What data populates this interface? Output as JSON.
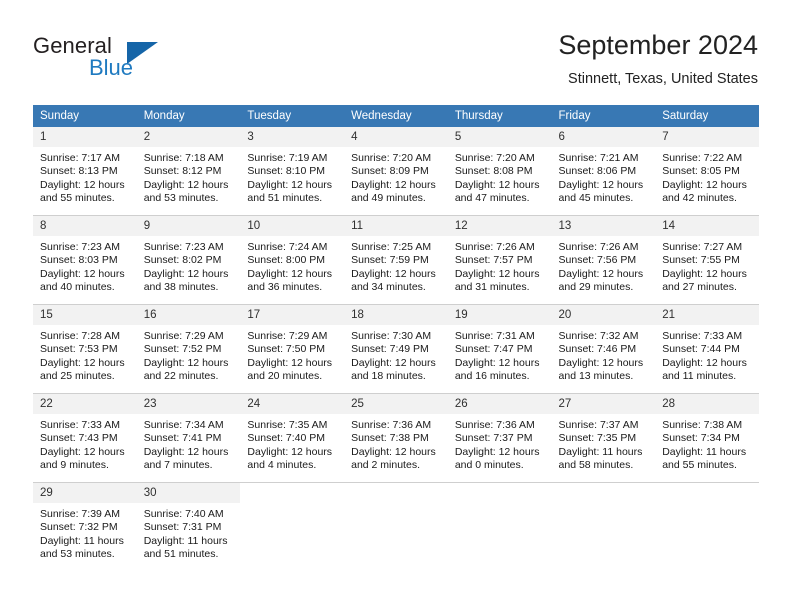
{
  "logo": {
    "word_one": "General",
    "word_two": "Blue",
    "triangle_color": "#1565a8",
    "blue_color": "#1f7ac0"
  },
  "header": {
    "title": "September 2024",
    "subtitle": "Stinnett, Texas, United States"
  },
  "theme": {
    "header_row_bg": "#3878b4",
    "daynum_bg": "#f2f2f2",
    "grid_line": "#cfcfcf"
  },
  "weekday_headers": [
    "Sunday",
    "Monday",
    "Tuesday",
    "Wednesday",
    "Thursday",
    "Friday",
    "Saturday"
  ],
  "labels": {
    "sunrise_prefix": "Sunrise:",
    "sunset_prefix": "Sunset:",
    "daylight_prefix": "Daylight:"
  },
  "weeks": [
    [
      {
        "day": "1",
        "sunrise": "Sunrise: 7:17 AM",
        "sunset": "Sunset: 8:13 PM",
        "daylight": "Daylight: 12 hours and 55 minutes."
      },
      {
        "day": "2",
        "sunrise": "Sunrise: 7:18 AM",
        "sunset": "Sunset: 8:12 PM",
        "daylight": "Daylight: 12 hours and 53 minutes."
      },
      {
        "day": "3",
        "sunrise": "Sunrise: 7:19 AM",
        "sunset": "Sunset: 8:10 PM",
        "daylight": "Daylight: 12 hours and 51 minutes."
      },
      {
        "day": "4",
        "sunrise": "Sunrise: 7:20 AM",
        "sunset": "Sunset: 8:09 PM",
        "daylight": "Daylight: 12 hours and 49 minutes."
      },
      {
        "day": "5",
        "sunrise": "Sunrise: 7:20 AM",
        "sunset": "Sunset: 8:08 PM",
        "daylight": "Daylight: 12 hours and 47 minutes."
      },
      {
        "day": "6",
        "sunrise": "Sunrise: 7:21 AM",
        "sunset": "Sunset: 8:06 PM",
        "daylight": "Daylight: 12 hours and 45 minutes."
      },
      {
        "day": "7",
        "sunrise": "Sunrise: 7:22 AM",
        "sunset": "Sunset: 8:05 PM",
        "daylight": "Daylight: 12 hours and 42 minutes."
      }
    ],
    [
      {
        "day": "8",
        "sunrise": "Sunrise: 7:23 AM",
        "sunset": "Sunset: 8:03 PM",
        "daylight": "Daylight: 12 hours and 40 minutes."
      },
      {
        "day": "9",
        "sunrise": "Sunrise: 7:23 AM",
        "sunset": "Sunset: 8:02 PM",
        "daylight": "Daylight: 12 hours and 38 minutes."
      },
      {
        "day": "10",
        "sunrise": "Sunrise: 7:24 AM",
        "sunset": "Sunset: 8:00 PM",
        "daylight": "Daylight: 12 hours and 36 minutes."
      },
      {
        "day": "11",
        "sunrise": "Sunrise: 7:25 AM",
        "sunset": "Sunset: 7:59 PM",
        "daylight": "Daylight: 12 hours and 34 minutes."
      },
      {
        "day": "12",
        "sunrise": "Sunrise: 7:26 AM",
        "sunset": "Sunset: 7:57 PM",
        "daylight": "Daylight: 12 hours and 31 minutes."
      },
      {
        "day": "13",
        "sunrise": "Sunrise: 7:26 AM",
        "sunset": "Sunset: 7:56 PM",
        "daylight": "Daylight: 12 hours and 29 minutes."
      },
      {
        "day": "14",
        "sunrise": "Sunrise: 7:27 AM",
        "sunset": "Sunset: 7:55 PM",
        "daylight": "Daylight: 12 hours and 27 minutes."
      }
    ],
    [
      {
        "day": "15",
        "sunrise": "Sunrise: 7:28 AM",
        "sunset": "Sunset: 7:53 PM",
        "daylight": "Daylight: 12 hours and 25 minutes."
      },
      {
        "day": "16",
        "sunrise": "Sunrise: 7:29 AM",
        "sunset": "Sunset: 7:52 PM",
        "daylight": "Daylight: 12 hours and 22 minutes."
      },
      {
        "day": "17",
        "sunrise": "Sunrise: 7:29 AM",
        "sunset": "Sunset: 7:50 PM",
        "daylight": "Daylight: 12 hours and 20 minutes."
      },
      {
        "day": "18",
        "sunrise": "Sunrise: 7:30 AM",
        "sunset": "Sunset: 7:49 PM",
        "daylight": "Daylight: 12 hours and 18 minutes."
      },
      {
        "day": "19",
        "sunrise": "Sunrise: 7:31 AM",
        "sunset": "Sunset: 7:47 PM",
        "daylight": "Daylight: 12 hours and 16 minutes."
      },
      {
        "day": "20",
        "sunrise": "Sunrise: 7:32 AM",
        "sunset": "Sunset: 7:46 PM",
        "daylight": "Daylight: 12 hours and 13 minutes."
      },
      {
        "day": "21",
        "sunrise": "Sunrise: 7:33 AM",
        "sunset": "Sunset: 7:44 PM",
        "daylight": "Daylight: 12 hours and 11 minutes."
      }
    ],
    [
      {
        "day": "22",
        "sunrise": "Sunrise: 7:33 AM",
        "sunset": "Sunset: 7:43 PM",
        "daylight": "Daylight: 12 hours and 9 minutes."
      },
      {
        "day": "23",
        "sunrise": "Sunrise: 7:34 AM",
        "sunset": "Sunset: 7:41 PM",
        "daylight": "Daylight: 12 hours and 7 minutes."
      },
      {
        "day": "24",
        "sunrise": "Sunrise: 7:35 AM",
        "sunset": "Sunset: 7:40 PM",
        "daylight": "Daylight: 12 hours and 4 minutes."
      },
      {
        "day": "25",
        "sunrise": "Sunrise: 7:36 AM",
        "sunset": "Sunset: 7:38 PM",
        "daylight": "Daylight: 12 hours and 2 minutes."
      },
      {
        "day": "26",
        "sunrise": "Sunrise: 7:36 AM",
        "sunset": "Sunset: 7:37 PM",
        "daylight": "Daylight: 12 hours and 0 minutes."
      },
      {
        "day": "27",
        "sunrise": "Sunrise: 7:37 AM",
        "sunset": "Sunset: 7:35 PM",
        "daylight": "Daylight: 11 hours and 58 minutes."
      },
      {
        "day": "28",
        "sunrise": "Sunrise: 7:38 AM",
        "sunset": "Sunset: 7:34 PM",
        "daylight": "Daylight: 11 hours and 55 minutes."
      }
    ],
    [
      {
        "day": "29",
        "sunrise": "Sunrise: 7:39 AM",
        "sunset": "Sunset: 7:32 PM",
        "daylight": "Daylight: 11 hours and 53 minutes."
      },
      {
        "day": "30",
        "sunrise": "Sunrise: 7:40 AM",
        "sunset": "Sunset: 7:31 PM",
        "daylight": "Daylight: 11 hours and 51 minutes."
      },
      null,
      null,
      null,
      null,
      null
    ]
  ]
}
